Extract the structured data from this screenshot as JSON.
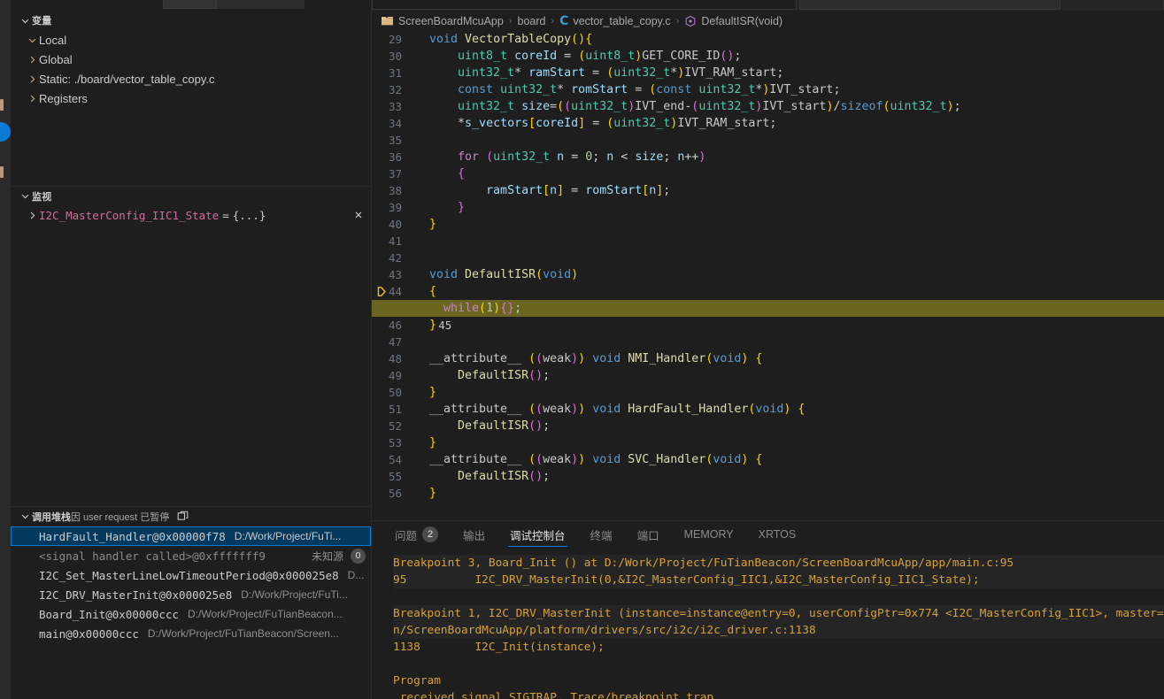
{
  "activity": {
    "badge_name": "debug-badge"
  },
  "sidebar": {
    "variables": {
      "title": "变量",
      "items": [
        {
          "label": "Local",
          "expanded": true
        },
        {
          "label": "Global",
          "expanded": false
        },
        {
          "label": "Static: ./board/vector_table_copy.c",
          "expanded": false
        },
        {
          "label": "Registers",
          "expanded": false
        }
      ]
    },
    "watch": {
      "title": "监视",
      "items": [
        {
          "name": "I2C_MasterConfig_IIC1_State",
          "eq": "=",
          "value": "{...}",
          "close": "✕"
        }
      ]
    },
    "callstack": {
      "title": "调用堆栈",
      "status": "user request 已暂停",
      "status_prefix": "因",
      "frames": [
        {
          "fn": "HardFault_Handler@0x00000f78",
          "src": "D:/Work/Project/FuTi...",
          "selected": true,
          "unknown": "",
          "count": ""
        },
        {
          "fn": "<signal handler called>@0xfffffff9",
          "src": "",
          "selected": false,
          "unknown": "未知源",
          "count": "0"
        },
        {
          "fn": "I2C_Set_MasterLineLowTimeoutPeriod@0x000025e8",
          "src": "D...",
          "selected": false,
          "unknown": "",
          "count": ""
        },
        {
          "fn": "I2C_DRV_MasterInit@0x000025e8",
          "src": "D:/Work/Project/FuTi...",
          "selected": false,
          "unknown": "",
          "count": ""
        },
        {
          "fn": "Board_Init@0x00000ccc",
          "src": "D:/Work/Project/FuTianBeacon...",
          "selected": false,
          "unknown": "",
          "count": ""
        },
        {
          "fn": "main@0x00000ccc",
          "src": "D:/Work/Project/FuTianBeacon/Screen...",
          "selected": false,
          "unknown": "",
          "count": ""
        }
      ]
    }
  },
  "breadcrumb": {
    "items": [
      {
        "label": "ScreenBoardMcuApp",
        "icon": "folder-icon"
      },
      {
        "label": "board",
        "icon": ""
      },
      {
        "label": "vector_table_copy.c",
        "icon": "c-file-icon"
      },
      {
        "label": "DefaultISR(void)",
        "icon": "symbol-method-icon"
      }
    ],
    "separator": "›"
  },
  "editor": {
    "current_line": 45,
    "breakpoint_line": 45,
    "lines": [
      {
        "n": 29,
        "text": "void VectorTableCopy(){"
      },
      {
        "n": 30,
        "text": "    uint8_t coreId = (uint8_t)GET_CORE_ID();"
      },
      {
        "n": 31,
        "text": "    uint32_t* ramStart = (uint32_t*)IVT_RAM_start;"
      },
      {
        "n": 32,
        "text": "    const uint32_t* romStart = (const uint32_t*)IVT_start;"
      },
      {
        "n": 33,
        "text": "    uint32_t size=((uint32_t)IVT_end-(uint32_t)IVT_start)/sizeof(uint32_t);"
      },
      {
        "n": 34,
        "text": "    *s_vectors[coreId] = (uint32_t)IVT_RAM_start;"
      },
      {
        "n": 35,
        "text": ""
      },
      {
        "n": 36,
        "text": "    for (uint32_t n = 0; n < size; n++)"
      },
      {
        "n": 37,
        "text": "    {"
      },
      {
        "n": 38,
        "text": "        ramStart[n] = romStart[n];"
      },
      {
        "n": 39,
        "text": "    }"
      },
      {
        "n": 40,
        "text": "}"
      },
      {
        "n": 41,
        "text": ""
      },
      {
        "n": 42,
        "text": ""
      },
      {
        "n": 43,
        "text": "void DefaultISR(void)"
      },
      {
        "n": 44,
        "text": "{"
      },
      {
        "n": 45,
        "text": "  while(1){};"
      },
      {
        "n": 46,
        "text": "}"
      },
      {
        "n": 47,
        "text": ""
      },
      {
        "n": 48,
        "text": "__attribute__ ((weak)) void NMI_Handler(void) {"
      },
      {
        "n": 49,
        "text": "    DefaultISR();"
      },
      {
        "n": 50,
        "text": "}"
      },
      {
        "n": 51,
        "text": "__attribute__ ((weak)) void HardFault_Handler(void) {"
      },
      {
        "n": 52,
        "text": "    DefaultISR();"
      },
      {
        "n": 53,
        "text": "}"
      },
      {
        "n": 54,
        "text": "__attribute__ ((weak)) void SVC_Handler(void) {"
      },
      {
        "n": 55,
        "text": "    DefaultISR();"
      },
      {
        "n": 56,
        "text": "}"
      }
    ]
  },
  "panel": {
    "tabs": [
      {
        "label": "问题",
        "badge": "2",
        "active": false
      },
      {
        "label": "输出",
        "badge": "",
        "active": false
      },
      {
        "label": "调试控制台",
        "badge": "",
        "active": true
      },
      {
        "label": "终端",
        "badge": "",
        "active": false
      },
      {
        "label": "端口",
        "badge": "",
        "active": false
      },
      {
        "label": "MEMORY",
        "badge": "",
        "active": false
      },
      {
        "label": "XRTOS",
        "badge": "",
        "active": false
      }
    ],
    "console": [
      {
        "text": "Breakpoint 3, Board_Init () at D:/Work/Project/FuTianBeacon/ScreenBoardMcuApp/app/main.c:95",
        "block": true
      },
      {
        "text": "95          I2C_DRV_MasterInit(0,&I2C_MasterConfig_IIC1,&I2C_MasterConfig_IIC1_State);",
        "block": true
      },
      {
        "text": "",
        "block": false
      },
      {
        "text": "Breakpoint 1, I2C_DRV_MasterInit (instance=instance@entry=0, userConfigPtr=0x774 <I2C_MasterConfig_IIC1>, master=",
        "block": true
      },
      {
        "text": "n/ScreenBoardMcuApp/platform/drivers/src/i2c/i2c_driver.c:1138",
        "block": true
      },
      {
        "text": "1138        I2C_Init(instance);",
        "block": false
      },
      {
        "text": "",
        "block": false
      },
      {
        "text": "Program",
        "block": false
      },
      {
        "text": " received signal SIGTRAP, Trace/breakpoint trap",
        "block": false
      }
    ]
  },
  "colors": {
    "accent": "#0a7ad4",
    "current_line_bg": "#6b6522",
    "selection_bg": "#04395e",
    "console_text": "#d7a13b"
  }
}
